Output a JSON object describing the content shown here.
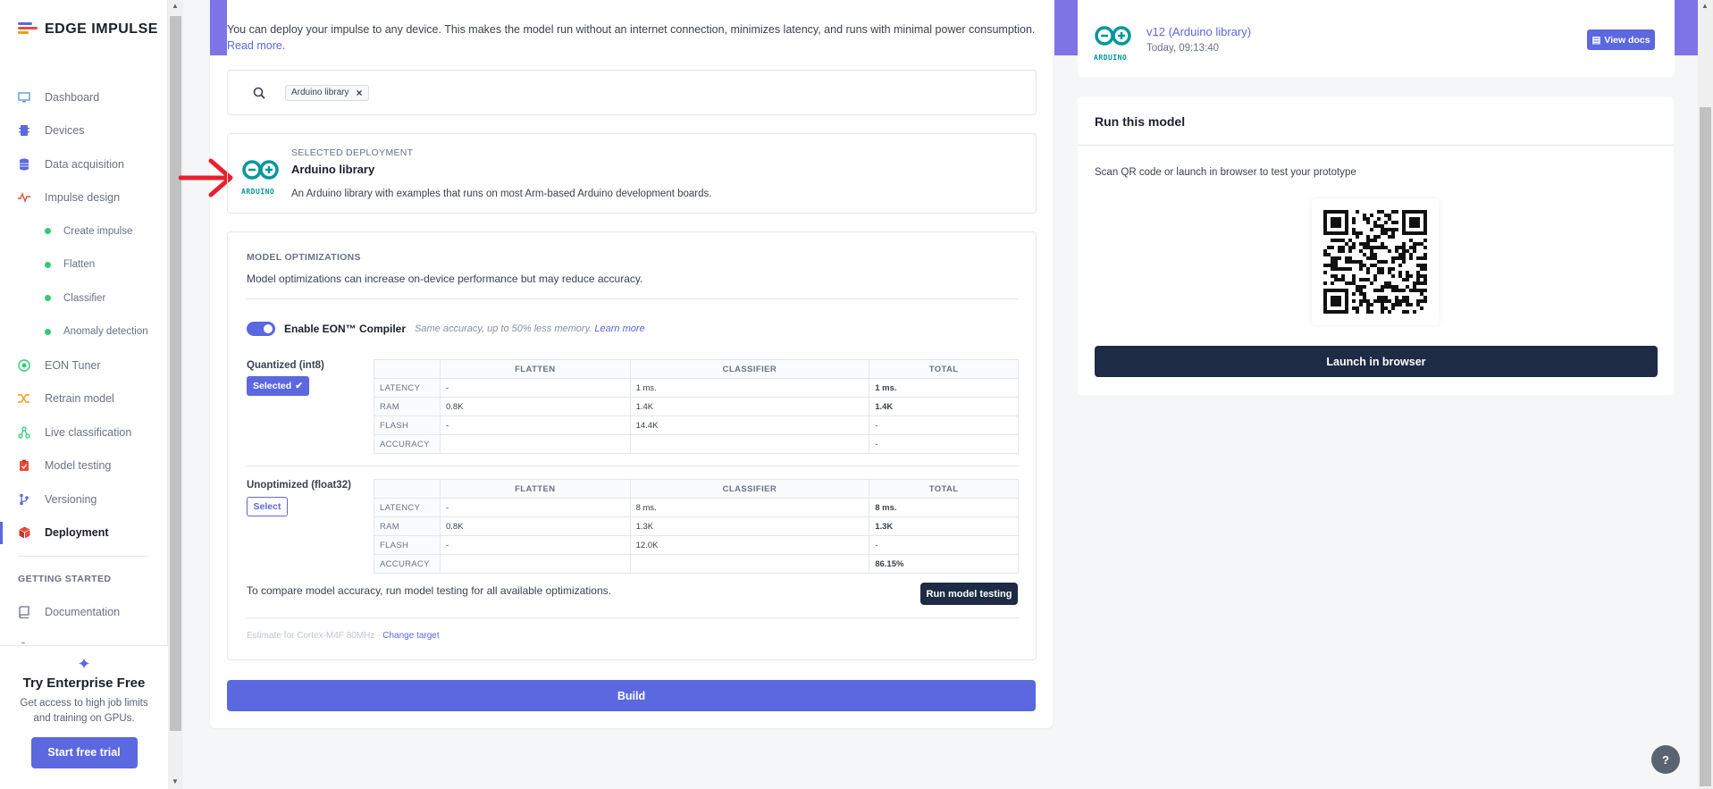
{
  "brand": {
    "name": "EDGE IMPULSE"
  },
  "sidebar": {
    "items": [
      {
        "label": "Dashboard",
        "icon": "monitor-icon",
        "color": "#5b9bd5"
      },
      {
        "label": "Devices",
        "icon": "chip-icon",
        "color": "#5b68e0"
      },
      {
        "label": "Data acquisition",
        "icon": "database-icon",
        "color": "#5b68e0"
      },
      {
        "label": "Impulse design",
        "icon": "pulse-icon",
        "color": "#e74c3c"
      },
      {
        "label": "Create impulse",
        "sub": true
      },
      {
        "label": "Flatten",
        "sub": true
      },
      {
        "label": "Classifier",
        "sub": true
      },
      {
        "label": "Anomaly detection",
        "sub": true
      },
      {
        "label": "EON Tuner",
        "icon": "target-icon",
        "color": "#2ecc71"
      },
      {
        "label": "Retrain model",
        "icon": "shuffle-icon",
        "color": "#f39c12"
      },
      {
        "label": "Live classification",
        "icon": "graph-icon",
        "color": "#2ecc71"
      },
      {
        "label": "Model testing",
        "icon": "clipboard-icon",
        "color": "#e74c3c"
      },
      {
        "label": "Versioning",
        "icon": "branch-icon",
        "color": "#5b68e0"
      },
      {
        "label": "Deployment",
        "icon": "box-icon",
        "color": "#e74c3c",
        "active": true
      }
    ],
    "section_getting_started": "GETTING STARTED",
    "documentation": "Documentation",
    "enterprise": {
      "title": "Try Enterprise Free",
      "desc": "Get access to high job limits and training on GPUs.",
      "button": "Start free trial"
    }
  },
  "main": {
    "intro": "You can deploy your impulse to any device. This makes the model run without an internet connection, minimizes latency, and runs with minimal power consumption.",
    "read_more": "Read more.",
    "search_chip": "Arduino library",
    "selected_deployment": {
      "label": "SELECTED DEPLOYMENT",
      "name": "Arduino library",
      "desc": "An Arduino library with examples that runs on most Arm-based Arduino development boards.",
      "logo_text": "ARDUINO"
    },
    "optimizations": {
      "title": "MODEL OPTIMIZATIONS",
      "desc": "Model optimizations can increase on-device performance but may reduce accuracy.",
      "eon_label": "Enable EON™ Compiler",
      "eon_note": "Same accuracy, up to 50% less memory.",
      "eon_link": "Learn more",
      "eon_enabled": true,
      "columns": [
        "",
        "FLATTEN",
        "CLASSIFIER",
        "TOTAL"
      ],
      "quantized": {
        "label": "Quantized (int8)",
        "button": "Selected",
        "rows": [
          [
            "LATENCY",
            "-",
            "1 ms.",
            "1 ms."
          ],
          [
            "RAM",
            "0.8K",
            "1.4K",
            "1.4K"
          ],
          [
            "FLASH",
            "-",
            "14.4K",
            "-"
          ],
          [
            "ACCURACY",
            "",
            "",
            "-"
          ]
        ]
      },
      "unoptimized": {
        "label": "Unoptimized (float32)",
        "button": "Select",
        "rows": [
          [
            "LATENCY",
            "-",
            "8 ms.",
            "8 ms."
          ],
          [
            "RAM",
            "0.8K",
            "1.3K",
            "1.3K"
          ],
          [
            "FLASH",
            "-",
            "12.0K",
            "-"
          ],
          [
            "ACCURACY",
            "",
            "",
            "86.15%"
          ]
        ]
      },
      "compare_text": "To compare model accuracy, run model testing for all available optimizations.",
      "run_testing": "Run model testing",
      "estimate": "Estimate for Cortex-M4F 80MHz - ",
      "change_target": "Change target"
    },
    "build": "Build"
  },
  "version": {
    "name": "v12 (Arduino library)",
    "time": "Today, 09:13:40",
    "view_docs": "View docs"
  },
  "run_model": {
    "title": "Run this model",
    "desc": "Scan QR code or launch in browser to test your prototype",
    "launch": "Launch in browser"
  },
  "colors": {
    "accent": "#5b68e0",
    "dark": "#1d2b45",
    "arduino": "#00979d",
    "banner": "#7e74e6"
  }
}
